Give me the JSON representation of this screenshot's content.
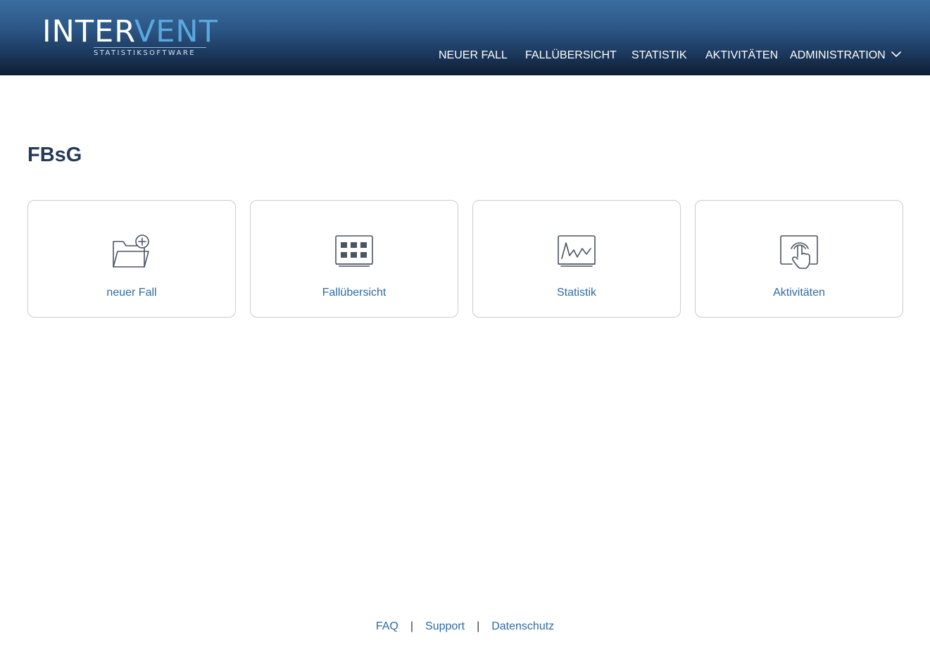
{
  "header": {
    "logo": {
      "part1": "INTER",
      "part2": "VENT",
      "subtitle": "STATISTIKSOFTWARE"
    },
    "nav": [
      {
        "label": "NEUER FALL"
      },
      {
        "label": "FALLÜBERSICHT"
      },
      {
        "label": "STATISTIK"
      },
      {
        "label": "AKTIVITÄTEN"
      },
      {
        "label": "ADMINISTRATION",
        "icon": "chevron-down-icon"
      }
    ]
  },
  "main": {
    "title": "FBsG",
    "tiles": [
      {
        "label": "neuer Fall",
        "icon": "folder-add-icon"
      },
      {
        "label": "Fallübersicht",
        "icon": "grid-table-icon"
      },
      {
        "label": "Statistik",
        "icon": "chart-monitor-icon"
      },
      {
        "label": "Aktivitäten",
        "icon": "touch-screen-icon"
      }
    ]
  },
  "footer": {
    "links": [
      {
        "label": "FAQ"
      },
      {
        "label": "Support"
      },
      {
        "label": "Datenschutz"
      }
    ],
    "separator": "|"
  },
  "colors": {
    "header_top": "#3a6ea0",
    "header_bottom": "#0e1d33",
    "logo_accent": "#5aa8df",
    "link": "#2d6aa3",
    "title": "#253a57",
    "tile_border": "#c9ccd0",
    "icon_stroke": "#4a5563"
  }
}
